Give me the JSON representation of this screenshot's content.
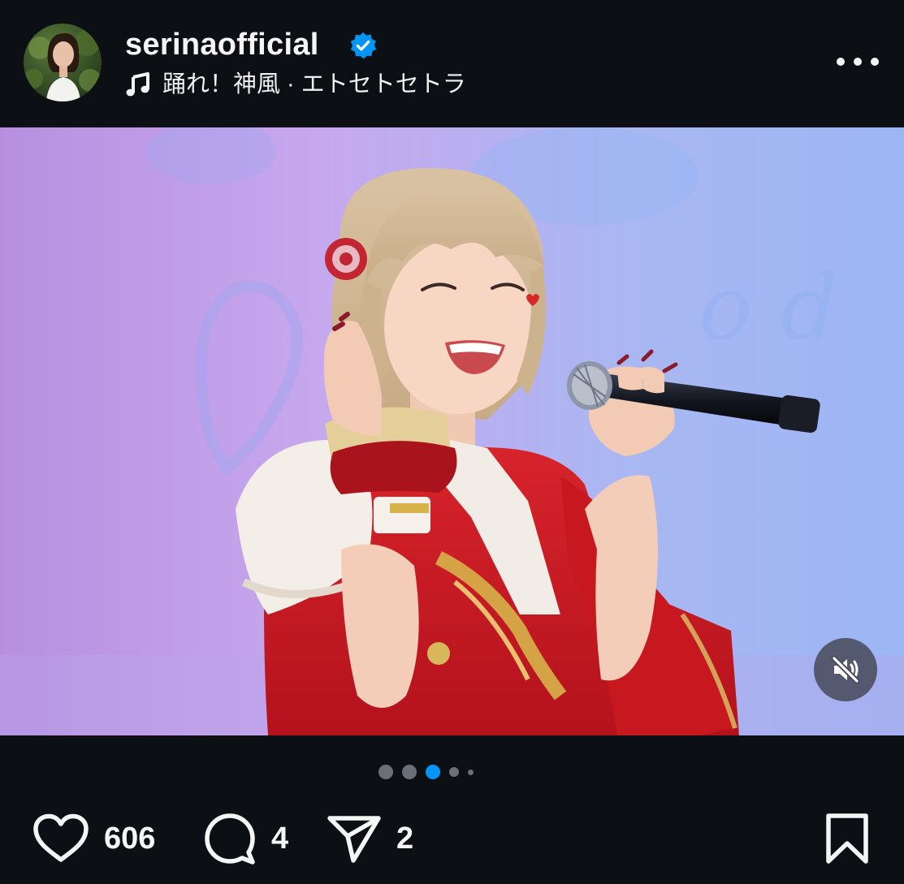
{
  "header": {
    "username": "serinaofficial",
    "verified": true,
    "music_title": "踊れ！神風 · エトセトセトラ",
    "more_icon": "more-horizontal-icon"
  },
  "media": {
    "description": "photo post",
    "muted": true,
    "mute_icon": "speaker-muted-icon"
  },
  "carousel": {
    "total_visible_dots": 5,
    "active_index": 2
  },
  "actions": {
    "like_count": "606",
    "comment_count": "4",
    "share_count": "2",
    "like_icon": "heart-icon",
    "comment_icon": "comment-bubble-icon",
    "share_icon": "paper-plane-icon",
    "save_icon": "bookmark-icon"
  },
  "colors": {
    "background": "#0c1014",
    "accent": "#0095f6",
    "verified_badge": "#0095f6",
    "text": "#f5f5f5"
  }
}
